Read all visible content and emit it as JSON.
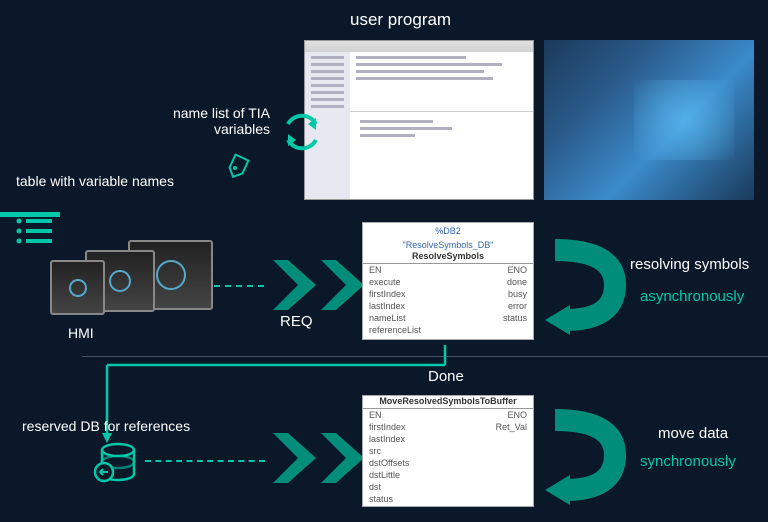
{
  "top": {
    "title": "user program",
    "namelist": "name list of TIA variables",
    "table_label": "table with variable names"
  },
  "hmi": {
    "label": "HMI",
    "req": "REQ"
  },
  "fb1": {
    "id": "%DB2",
    "name": "\"ResolveSymbols_DB\"",
    "title": "ResolveSymbols",
    "left": [
      "EN",
      "execute",
      "firstIndex",
      "lastIndex",
      "nameList",
      "referenceList"
    ],
    "right": [
      "ENO",
      "done",
      "busy",
      "error",
      "status",
      ""
    ]
  },
  "resolve": {
    "label": "resolving symbols",
    "mode": "asynchronously"
  },
  "done": "Done",
  "db": {
    "label": "reserved DB for references"
  },
  "fb2": {
    "title": "MoveResolvedSymbolsToBuffer",
    "left": [
      "EN",
      "firstIndex",
      "lastIndex",
      "src",
      "dstOffsets",
      "dstLittle",
      "dst",
      "status"
    ],
    "right": [
      "ENO",
      "Ret_Val",
      "",
      "",
      "",
      "",
      "",
      ""
    ]
  },
  "move": {
    "label": "move data",
    "mode": "synchronously"
  },
  "icons": {
    "recycle": "recycle-arrows-icon",
    "tag": "tag-icon",
    "list": "list-icon",
    "chevron": "chevron-right-icon",
    "curve": "curve-arrow-icon",
    "db": "database-back-icon"
  }
}
